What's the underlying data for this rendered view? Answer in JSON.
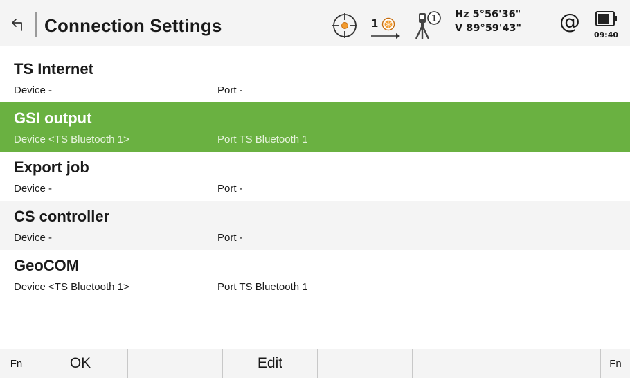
{
  "header": {
    "title": "Connection Settings",
    "prism_number": "1",
    "tripod_number": "1",
    "hz_angle": "Hz 5°56'36\"",
    "v_angle": "V  89°59'43\"",
    "at_symbol": "@",
    "time": "09:40"
  },
  "list": {
    "items": [
      {
        "title": "TS Internet",
        "device": "Device  -",
        "port": "Port  -"
      },
      {
        "title": "GSI output",
        "device": "Device  <TS Bluetooth 1>",
        "port": "Port  TS Bluetooth 1"
      },
      {
        "title": "Export job",
        "device": "Device  -",
        "port": "Port  -"
      },
      {
        "title": "CS controller",
        "device": "Device  -",
        "port": "Port  -"
      },
      {
        "title": "GeoCOM",
        "device": "Device  <TS Bluetooth 1>",
        "port": "Port  TS Bluetooth 1"
      }
    ],
    "selected_index": 1
  },
  "footer": {
    "fn_left": "Fn",
    "key1": "OK",
    "key2": "",
    "key3": "Edit",
    "key4": "",
    "key5": "",
    "fn_right": "Fn"
  },
  "colors": {
    "selection": "#6ab141",
    "header_bg": "#f4f4f4",
    "prism_orange": "#f29b2f"
  }
}
